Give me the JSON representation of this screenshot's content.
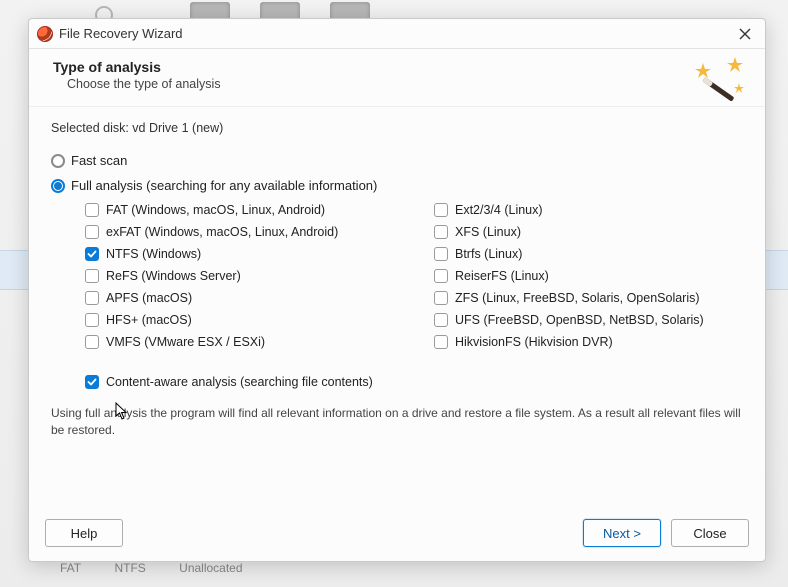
{
  "window": {
    "title": "File Recovery Wizard"
  },
  "header": {
    "title": "Type of analysis",
    "subtitle": "Choose the type of analysis"
  },
  "selected_disk_label": "Selected disk: vd Drive 1 (new)",
  "scan_modes": {
    "fast": {
      "label": "Fast scan",
      "selected": false
    },
    "full": {
      "label": "Full analysis (searching for any available information)",
      "selected": true
    }
  },
  "filesystems": {
    "left": [
      {
        "key": "fat",
        "label": "FAT (Windows, macOS, Linux, Android)",
        "checked": false
      },
      {
        "key": "exfat",
        "label": "exFAT (Windows, macOS, Linux, Android)",
        "checked": false
      },
      {
        "key": "ntfs",
        "label": "NTFS (Windows)",
        "checked": true
      },
      {
        "key": "refs",
        "label": "ReFS (Windows Server)",
        "checked": false
      },
      {
        "key": "apfs",
        "label": "APFS (macOS)",
        "checked": false
      },
      {
        "key": "hfs",
        "label": "HFS+ (macOS)",
        "checked": false
      },
      {
        "key": "vmfs",
        "label": "VMFS (VMware ESX / ESXi)",
        "checked": false
      }
    ],
    "right": [
      {
        "key": "ext",
        "label": "Ext2/3/4 (Linux)",
        "checked": false
      },
      {
        "key": "xfs",
        "label": "XFS (Linux)",
        "checked": false
      },
      {
        "key": "btrfs",
        "label": "Btrfs (Linux)",
        "checked": false
      },
      {
        "key": "reiserfs",
        "label": "ReiserFS (Linux)",
        "checked": false
      },
      {
        "key": "zfs",
        "label": "ZFS (Linux, FreeBSD, Solaris, OpenSolaris)",
        "checked": false
      },
      {
        "key": "ufs",
        "label": "UFS (FreeBSD, OpenBSD, NetBSD, Solaris)",
        "checked": false
      },
      {
        "key": "hikfs",
        "label": "HikvisionFS (Hikvision DVR)",
        "checked": false
      }
    ]
  },
  "content_aware": {
    "label": "Content-aware analysis (searching file contents)",
    "checked": true
  },
  "hint": "Using full analysis the program will find all relevant information on a drive and restore a file system. As a result all relevant files will be restored.",
  "buttons": {
    "help": "Help",
    "next": "Next >",
    "close": "Close"
  },
  "bg_status": {
    "a": "FAT",
    "b": "NTFS",
    "c": "Unallocated"
  }
}
